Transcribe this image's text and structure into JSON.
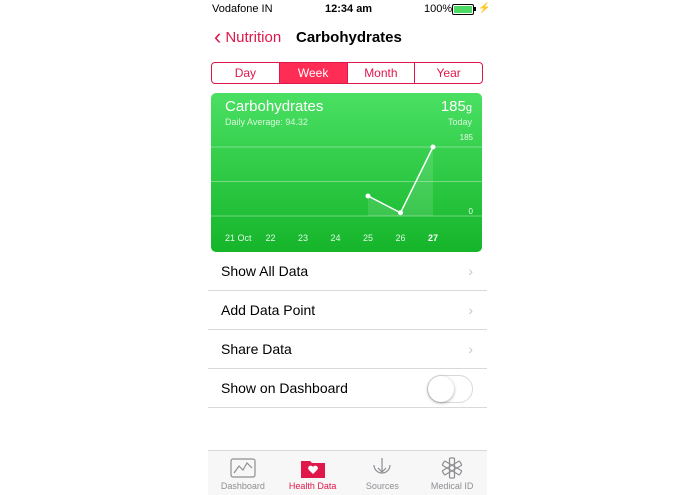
{
  "status": {
    "carrier": "Vodafone IN",
    "time": "12:34 am",
    "battery": "100%"
  },
  "nav": {
    "back_label": "Nutrition",
    "title": "Carbohydrates"
  },
  "segments": [
    "Day",
    "Week",
    "Month",
    "Year"
  ],
  "active_segment": "Week",
  "card": {
    "title": "Carbohydrates",
    "subtitle": "Daily Average: 94.32",
    "value": "185",
    "unit": "g",
    "today_label": "Today"
  },
  "chart_data": {
    "type": "line",
    "categories": [
      "21 Oct",
      "22",
      "23",
      "24",
      "25",
      "26",
      "27"
    ],
    "values": [
      null,
      null,
      null,
      null,
      53.7,
      8.6,
      185
    ],
    "ylim": [
      0,
      185
    ],
    "ytick_labels": [
      "185",
      "0"
    ],
    "highlight_category": "27",
    "grid": true
  },
  "rows": [
    {
      "label": "Show All Data",
      "type": "link"
    },
    {
      "label": "Add Data Point",
      "type": "link"
    },
    {
      "label": "Share Data",
      "type": "link"
    },
    {
      "label": "Show on Dashboard",
      "type": "toggle",
      "value": false
    }
  ],
  "tabs": [
    {
      "label": "Dashboard",
      "icon": "dashboard-icon"
    },
    {
      "label": "Health Data",
      "icon": "health-data-icon"
    },
    {
      "label": "Sources",
      "icon": "sources-icon"
    },
    {
      "label": "Medical ID",
      "icon": "medical-id-icon"
    }
  ],
  "active_tab": "Health Data",
  "colors": {
    "accent": "#e0174a",
    "card_top": "#4ae063",
    "card_bottom": "#15b52a"
  }
}
